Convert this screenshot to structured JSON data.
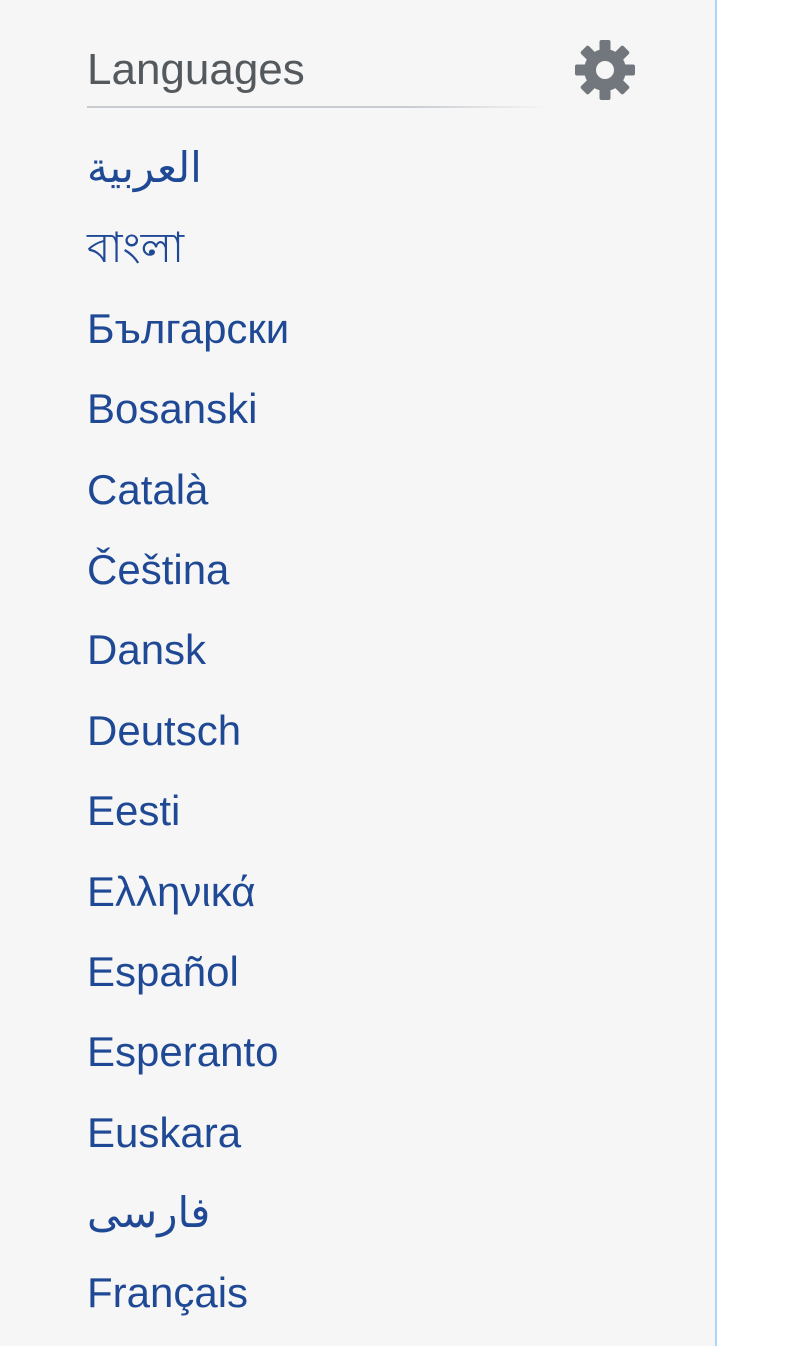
{
  "portal": {
    "title": "Languages",
    "settings_icon": "gear-icon",
    "languages": [
      "العربية",
      "বাংলা",
      "Български",
      "Bosanski",
      "Català",
      "Čeština",
      "Dansk",
      "Deutsch",
      "Eesti",
      "Ελληνικά",
      "Español",
      "Esperanto",
      "Euskara",
      "فارسی",
      "Français"
    ]
  },
  "colors": {
    "background": "#f6f6f6",
    "title_text": "#54595d",
    "link": "#1f4995",
    "gear": "#72777d",
    "border": "#a7d7f9"
  }
}
